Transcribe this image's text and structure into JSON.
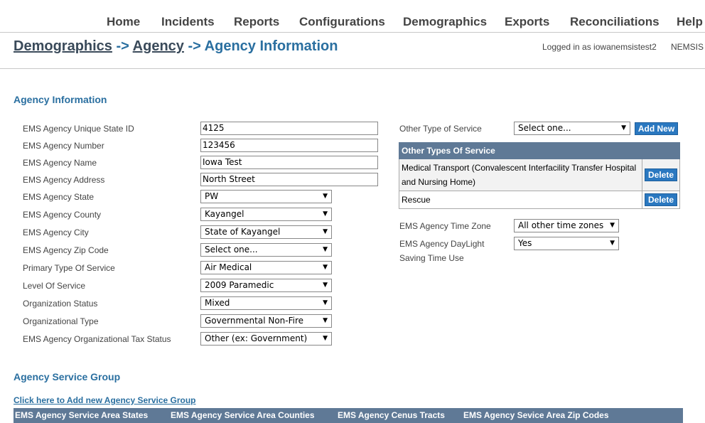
{
  "nav": {
    "items": [
      "Home",
      "Incidents",
      "Reports",
      "Configurations",
      "Demographics",
      "Exports",
      "Reconciliations",
      "Help"
    ]
  },
  "breadcrumb": {
    "level1": "Demographics",
    "sep": "->",
    "level2": "Agency",
    "current": "Agency Information"
  },
  "header": {
    "logged_in": "Logged in as iowanemsistest2",
    "nemsis": "NEMSIS"
  },
  "agency_info": {
    "title": "Agency Information",
    "fields": {
      "state_id": {
        "label": "EMS Agency Unique State ID",
        "value": "4125"
      },
      "number": {
        "label": "EMS Agency Number",
        "value": "123456"
      },
      "name": {
        "label": "EMS Agency Name",
        "value": "Iowa Test"
      },
      "address": {
        "label": "EMS Agency Address",
        "value": "North Street"
      },
      "state": {
        "label": "EMS Agency State",
        "value": "PW"
      },
      "county": {
        "label": "EMS Agency County",
        "value": "Kayangel"
      },
      "city": {
        "label": "EMS Agency City",
        "value": "State of Kayangel"
      },
      "zip": {
        "label": "EMS Agency Zip Code",
        "value": "Select one..."
      },
      "primary_service": {
        "label": "Primary Type Of Service",
        "value": "Air Medical"
      },
      "level_service": {
        "label": "Level Of Service",
        "value": "2009 Paramedic"
      },
      "org_status": {
        "label": "Organization Status",
        "value": "Mixed"
      },
      "org_type": {
        "label": "Organizational Type",
        "value": "Governmental Non-Fire"
      },
      "tax_status": {
        "label": "EMS Agency Organizational Tax Status",
        "value": "Other (ex: Government)"
      }
    },
    "other_service": {
      "label": "Other Type of Service",
      "value": "Select one...",
      "add_label": "Add New",
      "table_header": "Other Types Of Service",
      "rows": [
        {
          "name": "Medical Transport (Convalescent Interfacility Transfer Hospital and Nursing Home)",
          "delete": "Delete"
        },
        {
          "name": "Rescue",
          "delete": "Delete"
        }
      ]
    },
    "timezone": {
      "label": "EMS Agency Time Zone",
      "value": "All other time zones"
    },
    "daylight": {
      "label1": "EMS Agency DayLight",
      "label2": "Saving Time Use",
      "value": "Yes"
    }
  },
  "service_group": {
    "title": "Agency Service Group",
    "add_link": "Click here to Add new Agency Service Group",
    "columns": [
      "EMS Agency Service Area States",
      "EMS Agency Service Area Counties",
      "EMS Agency Cenus Tracts",
      "EMS Agency Sevice Area Zip Codes"
    ]
  },
  "icons": {
    "dropdown": "chevron-down-icon"
  }
}
